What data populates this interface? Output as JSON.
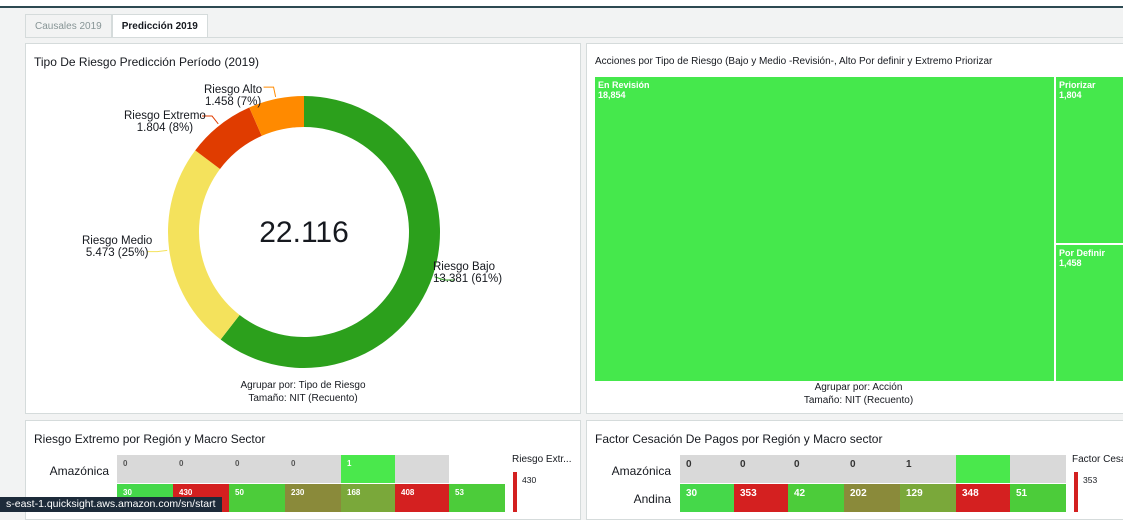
{
  "tabs": [
    {
      "label": "Causales 2019",
      "active": false
    },
    {
      "label": "Predicción 2019",
      "active": true
    }
  ],
  "donut": {
    "title": "Tipo De Riesgo Predicción Período (2019)",
    "center": "22.116",
    "group_by": "Agrupar por: Tipo de Riesgo",
    "size": "Tamaño: NIT (Recuento)",
    "labels": {
      "bajo_name": "Riesgo Bajo",
      "bajo_val": "13.381 (61%)",
      "medio_name": "Riesgo Medio",
      "medio_val": "5.473 (25%)",
      "extremo_name": "Riesgo Extremo",
      "extremo_val": "1.804 (8%)",
      "alto_name": "Riesgo Alto",
      "alto_val": "1.458 (7%)"
    }
  },
  "chart_data": [
    {
      "type": "pie",
      "title": "Tipo De Riesgo Predicción Período (2019)",
      "categories": [
        "Riesgo Bajo",
        "Riesgo Medio",
        "Riesgo Extremo",
        "Riesgo Alto"
      ],
      "values": [
        13381,
        5473,
        1804,
        1458
      ],
      "colors": [
        "#2ca01c",
        "#f4e25c",
        "#e03c00",
        "#ff8a00"
      ],
      "total": 22116
    },
    {
      "type": "treemap",
      "title": "Acciones por Tipo de Riesgo (Bajo y Medio -Revisión-, Alto Por definir y Extremo Priorizar",
      "categories": [
        "En Revisión",
        "Priorizar",
        "Por Definir"
      ],
      "values": [
        18854,
        1804,
        1458
      ]
    }
  ],
  "treemap": {
    "title": "Acciones por Tipo de Riesgo (Bajo y Medio -Revisión-, Alto Por definir y Extremo Priorizar",
    "group_by": "Agrupar por: Acción",
    "size": "Tamaño: NIT (Recuento)",
    "items": [
      {
        "name": "En Revisión",
        "value": "18,854"
      },
      {
        "name": "Priorizar",
        "value": "1,804"
      },
      {
        "name": "Por Definir",
        "value": "1,458"
      }
    ]
  },
  "heat1": {
    "title": "Riesgo Extremo por Región y Macro Sector",
    "rows": [
      "Amazónica"
    ],
    "row1_cells": [
      "0",
      "0",
      "0",
      "0",
      "1",
      ""
    ],
    "row2_cells": [
      "30",
      "430",
      "50",
      "230",
      "168",
      "408",
      "53"
    ],
    "legend_title": "Riesgo Extr...",
    "legend_max": "430"
  },
  "heat2": {
    "title": "Factor Cesación De Pagos por Región y Macro sector",
    "rows": [
      "Amazónica",
      "Andina"
    ],
    "row1_cells": [
      "0",
      "0",
      "0",
      "0",
      "1",
      ""
    ],
    "row2_cells": [
      "30",
      "353",
      "42",
      "202",
      "129",
      "348",
      "51"
    ],
    "legend_title": "Factor Cesa",
    "legend_max": "353"
  },
  "status_url": "s-east-1.quicksight.aws.amazon.com/sn/start"
}
